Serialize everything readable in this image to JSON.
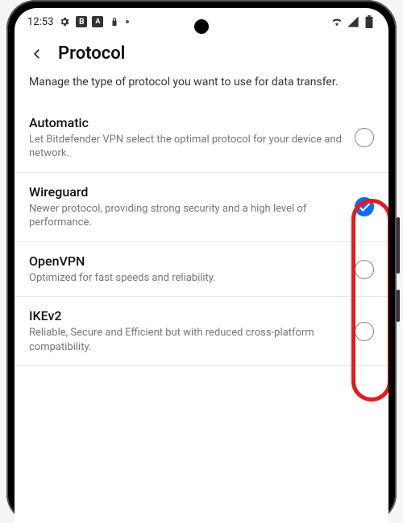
{
  "statusbar": {
    "time": "12:53"
  },
  "header": {
    "title": "Protocol"
  },
  "subtitle": "Manage the type of protocol you want to use for data transfer.",
  "options": [
    {
      "title": "Automatic",
      "desc": "Let Bitdefender VPN select the optimal protocol for your device and network.",
      "selected": false
    },
    {
      "title": "Wireguard",
      "desc": "Newer protocol, providing strong security and a high level of performance.",
      "selected": true
    },
    {
      "title": "OpenVPN",
      "desc": "Optimized for fast speeds and reliability.",
      "selected": false
    },
    {
      "title": "IKEv2",
      "desc": "Reliable, Secure and Efficient but with reduced cross-platform compatibility.",
      "selected": false
    }
  ],
  "highlight": {
    "color": "#e41b1b"
  }
}
